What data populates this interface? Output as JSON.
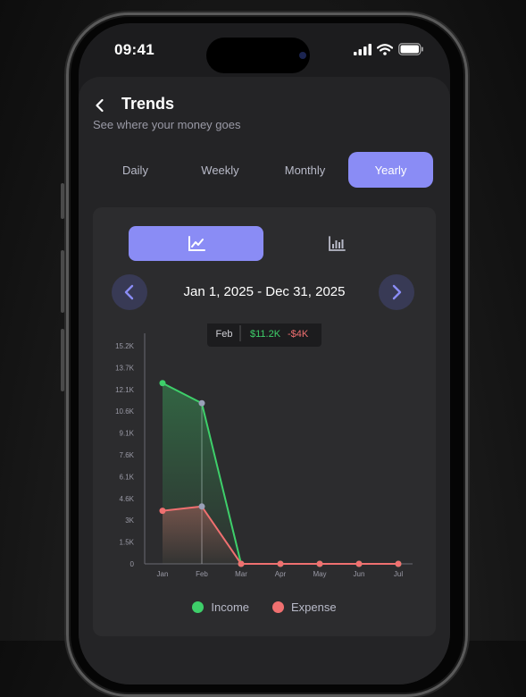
{
  "status": {
    "time": "09:41"
  },
  "header": {
    "title": "Trends",
    "subtitle": "See where your money goes"
  },
  "tabs": [
    {
      "label": "Daily",
      "active": false
    },
    {
      "label": "Weekly",
      "active": false
    },
    {
      "label": "Monthly",
      "active": false
    },
    {
      "label": "Yearly",
      "active": true
    }
  ],
  "chart_toggle": {
    "active": "line-chart",
    "options": [
      "line-chart-icon",
      "bar-chart-icon"
    ]
  },
  "date_range": "Jan 1, 2025 - Dec 31, 2025",
  "tooltip": {
    "month": "Feb",
    "income": "$11.2K",
    "expense": "-$4K"
  },
  "colors": {
    "accent": "#8a8cf5",
    "income": "#3ecf6a",
    "expense": "#f07070"
  },
  "chart_data": {
    "type": "line",
    "categories": [
      "Jan",
      "Feb",
      "Mar",
      "Apr",
      "May",
      "Jun",
      "Jul"
    ],
    "y_ticks": [
      "0",
      "1.5K",
      "3K",
      "4.6K",
      "6.1K",
      "7.6K",
      "9.1K",
      "10.6K",
      "12.1K",
      "13.7K",
      "15.2K"
    ],
    "ylim": [
      0,
      15200
    ],
    "series": [
      {
        "name": "Income",
        "values": [
          12600,
          11200,
          0,
          0,
          0,
          0,
          0
        ]
      },
      {
        "name": "Expense",
        "values": [
          3700,
          4000,
          0,
          0,
          0,
          0,
          0
        ]
      }
    ],
    "highlight_index": 1,
    "grid": false,
    "legend": "bottom-center"
  }
}
